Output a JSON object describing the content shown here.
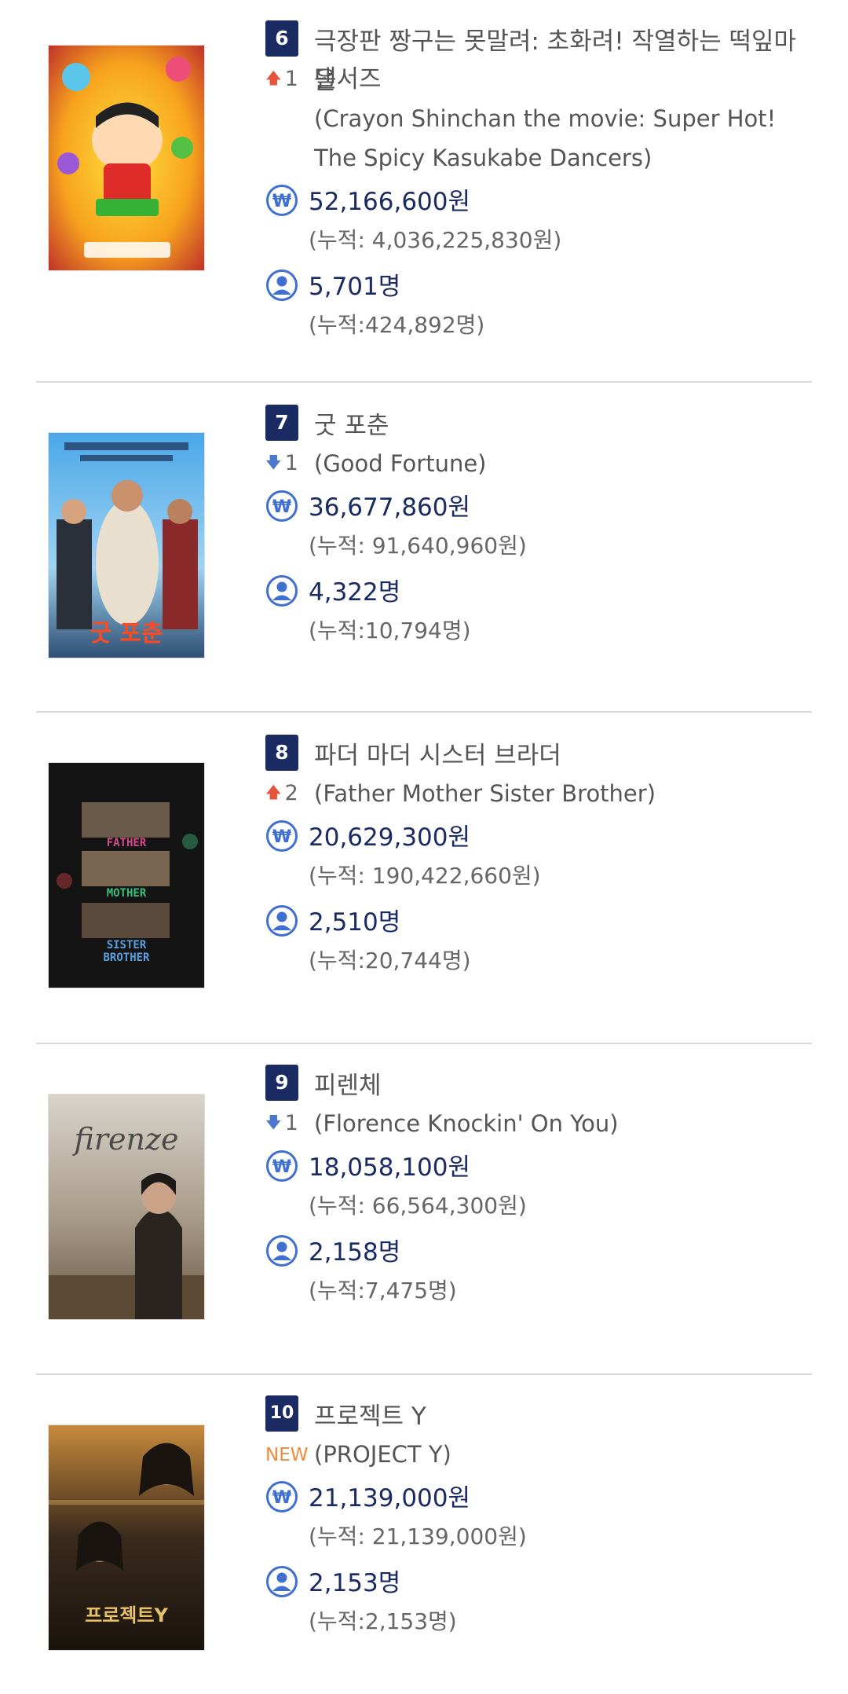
{
  "movies": [
    {
      "rank": "6",
      "change_dir": "up",
      "change_val": "1",
      "title_line1": "극장판 짱구는 못말려: 초화려! 작열하는 떡잎마을",
      "title_line2": "댄서즈",
      "orig_line1": "(Crayon Shinchan the movie: Super Hot!",
      "orig_line2": "The Spicy Kasukabe Dancers)",
      "sales": "52,166,600원",
      "sales_cum": "(누적: 4,036,225,830원)",
      "audience": "5,701명",
      "audience_cum": "(누적:424,892명)"
    },
    {
      "rank": "7",
      "change_dir": "down",
      "change_val": "1",
      "title": "굿 포춘",
      "orig": "(Good Fortune)",
      "sales": "36,677,860원",
      "sales_cum": "(누적: 91,640,960원)",
      "audience": "4,322명",
      "audience_cum": "(누적:10,794명)",
      "poster_caption": "굿 포춘"
    },
    {
      "rank": "8",
      "change_dir": "up",
      "change_val": "2",
      "title": "파더 마더 시스터 브라더",
      "orig": "(Father Mother Sister Brother)",
      "sales": "20,629,300원",
      "sales_cum": "(누적: 190,422,660원)",
      "audience": "2,510명",
      "audience_cum": "(누적:20,744명)",
      "poster_words": [
        "FATHER",
        "MOTHER",
        "SISTER",
        "BROTHER"
      ]
    },
    {
      "rank": "9",
      "change_dir": "down",
      "change_val": "1",
      "title": "피렌체",
      "orig": "(Florence Knockin' On You)",
      "sales": "18,058,100원",
      "sales_cum": "(누적: 66,564,300원)",
      "audience": "2,158명",
      "audience_cum": "(누적:7,475명)",
      "poster_caption": "firenze"
    },
    {
      "rank": "10",
      "change_new": "NEW",
      "title": "프로젝트 Y",
      "orig": "(PROJECT Y)",
      "sales": "21,139,000원",
      "sales_cum": "(누적: 21,139,000원)",
      "audience": "2,153명",
      "audience_cum": "(누적:2,153명)",
      "poster_caption": "프로젝트Y"
    }
  ],
  "icons": {
    "sales": "won-icon",
    "audience": "person-icon",
    "up": "arrow-up-icon",
    "down": "arrow-down-icon"
  },
  "colors": {
    "badge": "#1a2a63",
    "value": "#1a2a63",
    "up": "#e5533b",
    "down": "#4b77cf",
    "new": "#ee8c3a",
    "icon": "#3f6fd1"
  }
}
